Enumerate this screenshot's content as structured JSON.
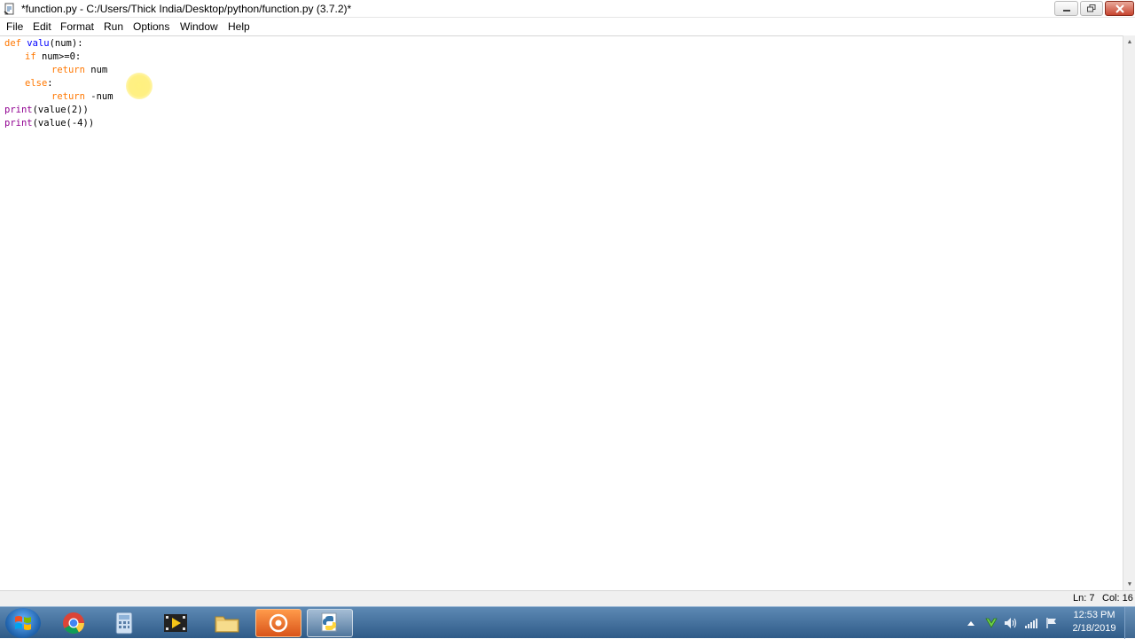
{
  "window": {
    "title": "*function.py - C:/Users/Thick India/Desktop/python/function.py (3.7.2)*"
  },
  "menu": [
    "File",
    "Edit",
    "Format",
    "Run",
    "Options",
    "Window",
    "Help"
  ],
  "code": {
    "line1": {
      "kw": "def",
      "name": "valu",
      "rest": "(num):"
    },
    "line2": {
      "kw": "if",
      "rest": "num>=0:"
    },
    "line3": {
      "kw": "return",
      "rest": "num"
    },
    "line4": {
      "kw": "else",
      "rest": ":"
    },
    "line5": {
      "kw": "return",
      "rest": "-num"
    },
    "line6": {
      "bi": "print",
      "rest": "(value(2))"
    },
    "line7": {
      "bi": "print",
      "rest": "(value(-4))"
    }
  },
  "status": {
    "ln": "Ln: 7",
    "col": "Col: 16"
  },
  "clock": {
    "time": "12:53 PM",
    "date": "2/18/2019"
  },
  "colors": {
    "keyword": "#ff7700",
    "builtin": "#900090",
    "defname": "#0000ff",
    "taskbar": "#3d6a97"
  },
  "taskbar": {
    "icons": [
      "windows-start-icon",
      "chrome-icon",
      "calculator-icon",
      "media-player-icon",
      "file-explorer-icon",
      "presentation-icon",
      "python-idle-icon"
    ]
  }
}
